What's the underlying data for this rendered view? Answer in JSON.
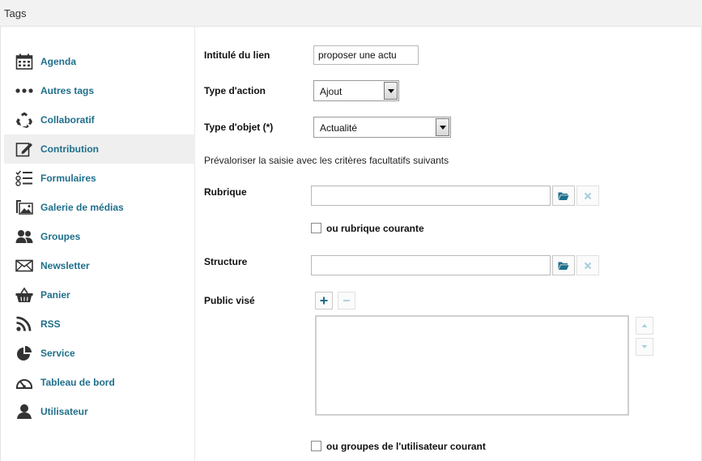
{
  "window": {
    "title": "Tags"
  },
  "sidebar": {
    "items": [
      {
        "label": "Agenda",
        "icon": "calendar-icon"
      },
      {
        "label": "Autres tags",
        "icon": "more-dots-icon"
      },
      {
        "label": "Collaboratif",
        "icon": "recycle-icon"
      },
      {
        "label": "Contribution",
        "icon": "edit-icon",
        "active": true
      },
      {
        "label": "Formulaires",
        "icon": "form-list-icon"
      },
      {
        "label": "Galerie de médias",
        "icon": "media-gallery-icon"
      },
      {
        "label": "Groupes",
        "icon": "group-icon"
      },
      {
        "label": "Newsletter",
        "icon": "envelope-icon"
      },
      {
        "label": "Panier",
        "icon": "basket-icon"
      },
      {
        "label": "RSS",
        "icon": "rss-icon"
      },
      {
        "label": "Service",
        "icon": "pie-chart-icon"
      },
      {
        "label": "Tableau de bord",
        "icon": "dashboard-icon"
      },
      {
        "label": "Utilisateur",
        "icon": "user-icon"
      }
    ]
  },
  "form": {
    "link_label": "Intitulé du lien",
    "link_value": "proposer une actu",
    "action_type_label": "Type d'action",
    "action_type_value": "Ajout",
    "object_type_label": "Type d'objet (*)",
    "object_type_value": "Actualité",
    "prefill_text": "Prévaloriser la saisie avec les critères facultatifs suivants",
    "rubrique_label": "Rubrique",
    "rubrique_value": "",
    "current_rubrique_label": "ou rubrique courante",
    "structure_label": "Structure",
    "structure_value": "",
    "audience_label": "Public visé",
    "current_user_groups_label": "ou groupes de l'utilisateur courant"
  },
  "colors": {
    "accent": "#1f6f8b",
    "active_bg": "#efefef"
  }
}
